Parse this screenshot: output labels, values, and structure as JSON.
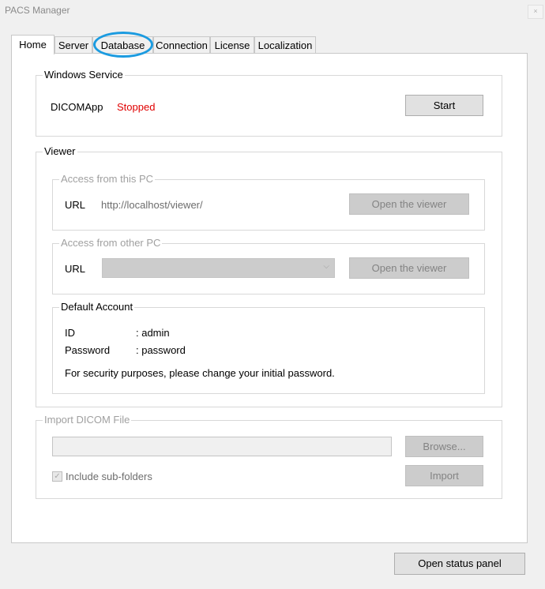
{
  "window": {
    "title": "PACS Manager",
    "close_glyph": "×"
  },
  "tabs": [
    "Home",
    "Server",
    "Database",
    "Connection",
    "License",
    "Localization"
  ],
  "windows_service": {
    "label": "Windows Service",
    "service_name": "DICOMApp",
    "status": "Stopped",
    "status_color": "#e00000",
    "start_label": "Start"
  },
  "viewer": {
    "label": "Viewer",
    "this_pc": {
      "label": "Access from this PC",
      "url_label": "URL",
      "url_value": "http://localhost/viewer/",
      "open_label": "Open the viewer"
    },
    "other_pc": {
      "label": "Access from other PC",
      "url_label": "URL",
      "url_value": "",
      "open_label": "Open the viewer"
    },
    "default_account": {
      "label": "Default Account",
      "id_label": "ID",
      "id_value": ": admin",
      "password_label": "Password",
      "password_value": ": password",
      "note": "For security purposes, please change your initial password."
    }
  },
  "import": {
    "label": "Import DICOM File",
    "path_value": "",
    "browse_label": "Browse...",
    "include_sub_label": "Include sub-folders",
    "include_sub_checked": true,
    "import_label": "Import"
  },
  "footer": {
    "status_panel_label": "Open status panel"
  },
  "colors": {
    "highlight_ring": "#1b9be0",
    "panel_bg": "#ffffff",
    "window_bg": "#f0f0f0"
  }
}
